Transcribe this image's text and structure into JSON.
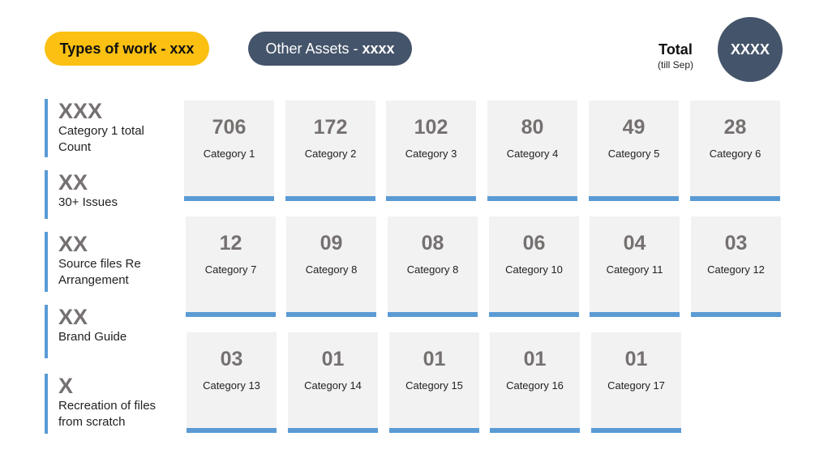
{
  "header": {
    "types_of_work_label": "Types of work - xxx",
    "other_assets_prefix": "Other Assets - ",
    "other_assets_value": "xxxx",
    "total_label": "Total",
    "total_sub": "(till Sep)",
    "total_value": "XXXX"
  },
  "sidebar": [
    {
      "value": "XXX",
      "label_line1": "Category 1 total",
      "label_line2": "Count"
    },
    {
      "value": "XX",
      "label_line1": "30+ Issues",
      "label_line2": ""
    },
    {
      "value": "XX",
      "label_line1": "Source files Re",
      "label_line2": "Arrangement"
    },
    {
      "value": "XX",
      "label_line1": "Brand Guide",
      "label_line2": ""
    },
    {
      "value": "X",
      "label_line1": "Recreation of files",
      "label_line2": "from scratch"
    }
  ],
  "cards": [
    {
      "value": "706",
      "label": "Category 1"
    },
    {
      "value": "172",
      "label": "Category 2"
    },
    {
      "value": "102",
      "label": "Category 3"
    },
    {
      "value": "80",
      "label": "Category 4"
    },
    {
      "value": "49",
      "label": "Category 5"
    },
    {
      "value": "28",
      "label": "Category 6"
    },
    {
      "value": "12",
      "label": "Category 7"
    },
    {
      "value": "09",
      "label": "Category 8"
    },
    {
      "value": "08",
      "label": "Category 8"
    },
    {
      "value": "06",
      "label": "Category 10"
    },
    {
      "value": "04",
      "label": "Category 11"
    },
    {
      "value": "03",
      "label": "Category 12"
    },
    {
      "value": "03",
      "label": "Category 13"
    },
    {
      "value": "01",
      "label": "Category 14"
    },
    {
      "value": "01",
      "label": "Category 15"
    },
    {
      "value": "01",
      "label": "Category 16"
    },
    {
      "value": "01",
      "label": "Category 17"
    }
  ]
}
